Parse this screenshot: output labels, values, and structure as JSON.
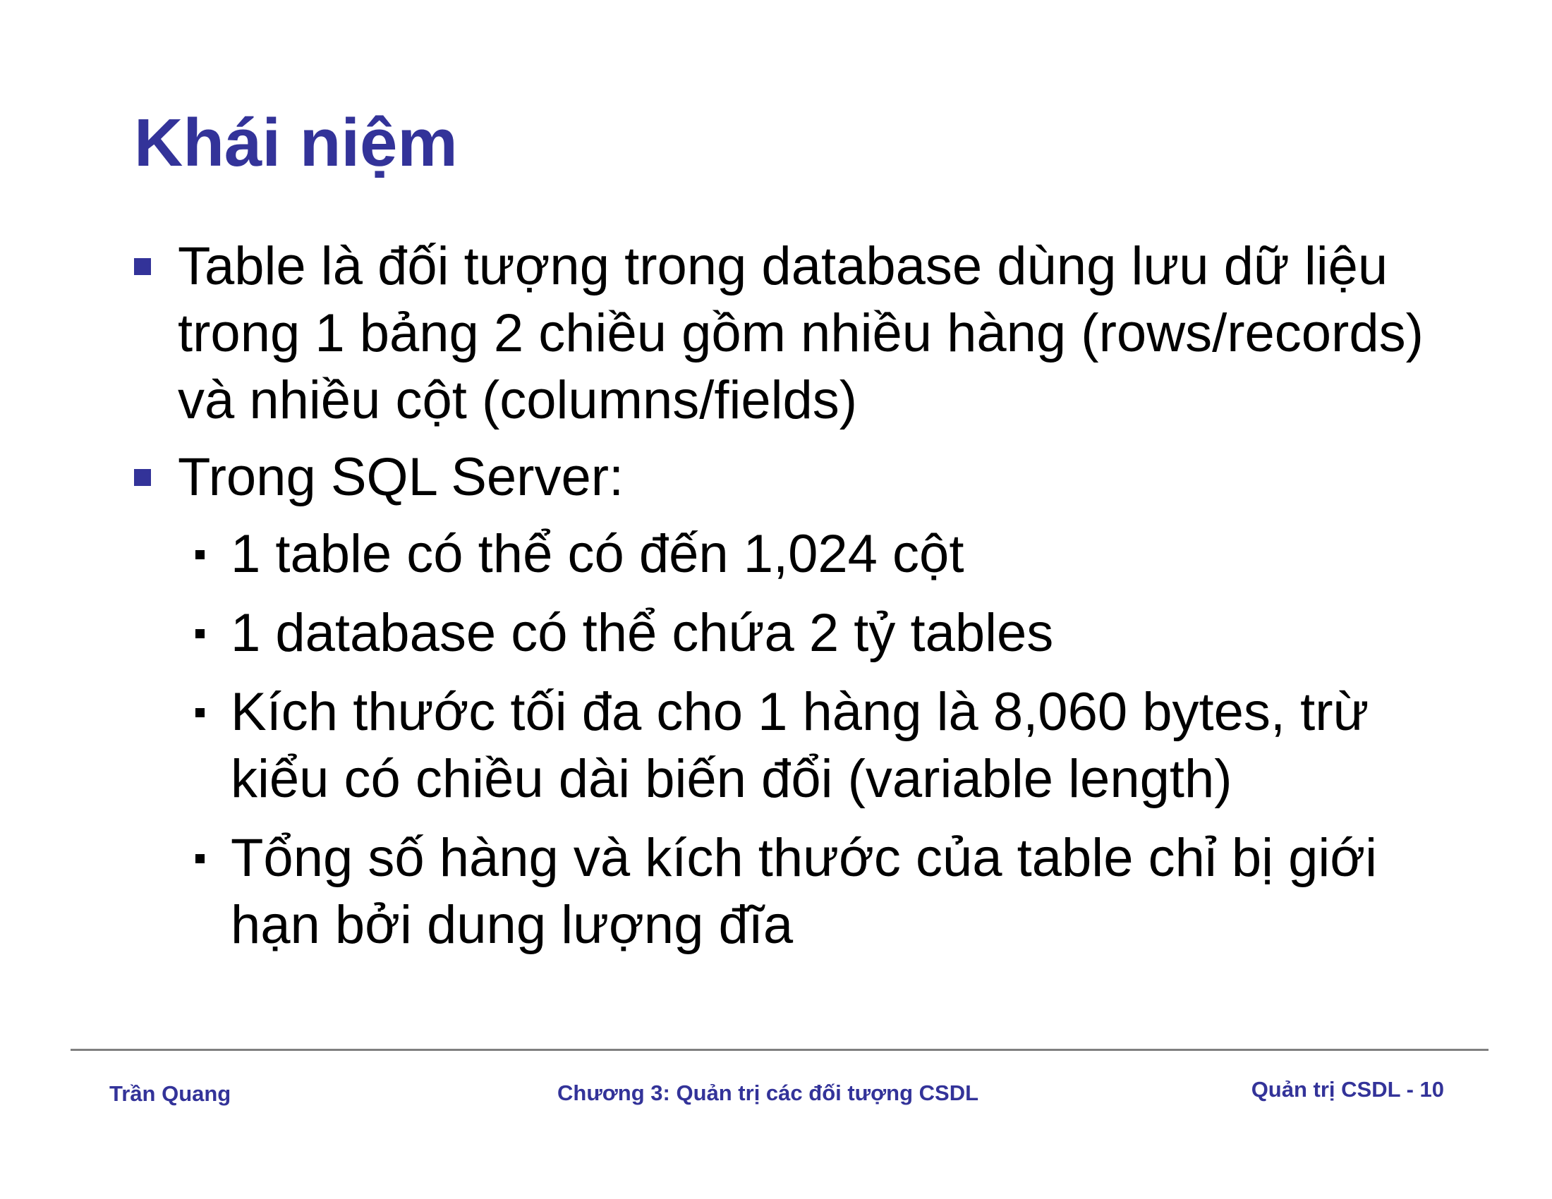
{
  "slide": {
    "title": "Khái niệm",
    "bullets": [
      {
        "text": "Table là đối tượng trong database dùng lưu dữ liệu trong 1 bảng 2 chiều gồm nhiều hàng (rows/records) và nhiều cột (columns/fields)"
      },
      {
        "text": "Trong SQL Server:",
        "sub": [
          "1 table có thể có đến 1,024 cột",
          "1 database có thể chứa 2 tỷ tables",
          "Kích thước tối đa cho 1 hàng là 8,060 bytes, trừ kiểu có chiều dài biến đổi (variable length)",
          "Tổng số hàng và kích thước của table chỉ bị giới hạn bởi dung lượng đĩa"
        ]
      }
    ]
  },
  "footer": {
    "author": "Trần Quang",
    "chapter": "Chương 3: Quản trị các đối tượng CSDL",
    "page": "Quản trị CSDL - 10"
  },
  "colors": {
    "accent": "#333399",
    "text": "#000000",
    "rule": "#808080"
  }
}
